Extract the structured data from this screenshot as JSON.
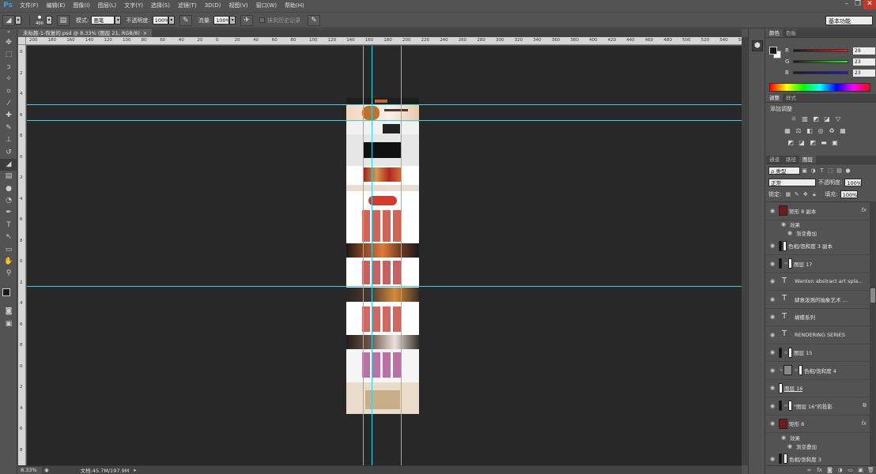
{
  "app": {
    "logo": "Ps"
  },
  "menu": [
    "文件(F)",
    "编辑(E)",
    "图像(I)",
    "图层(L)",
    "文字(Y)",
    "选择(S)",
    "滤镜(T)",
    "3D(D)",
    "视图(V)",
    "窗口(W)",
    "帮助(H)"
  ],
  "options": {
    "brush_size": "400",
    "mode_label": "模式:",
    "mode_value": "画笔",
    "opacity_label": "不透明度:",
    "opacity_value": "100%",
    "flow_label": "流量:",
    "flow_value": "100%",
    "history_label": "抹到历史记录",
    "workspace": "基本功能"
  },
  "document": {
    "tab_title": "未标题-1-恢复的.psd @ 8.33% (图层 21, RGB/8)",
    "zoom": "8.33%",
    "doc_size": "文档:45.7M/197.9M"
  },
  "rulers": {
    "h_ticks": [
      "200",
      "180",
      "160",
      "140",
      "120",
      "100",
      "80",
      "60",
      "40",
      "20",
      "0",
      "20",
      "40",
      "60",
      "80",
      "100",
      "120",
      "140",
      "160",
      "180",
      "200",
      "220",
      "240",
      "260",
      "280",
      "300",
      "320",
      "340",
      "360",
      "380",
      "400",
      "420",
      "440",
      "460",
      "480",
      "500",
      "520",
      "540",
      "560"
    ],
    "v_ticks": [
      "0",
      "2",
      "4",
      "6",
      "8",
      "0",
      "2",
      "4",
      "6",
      "8",
      "0",
      "2",
      "4",
      "6",
      "8",
      "0",
      "2",
      "4",
      "6",
      "8"
    ]
  },
  "color_panel": {
    "tabs": [
      "颜色",
      "色板"
    ],
    "r_label": "R",
    "r_value": "29",
    "g_label": "G",
    "g_value": "23",
    "b_label": "B",
    "b_value": "23",
    "fg_color": "#1d1717"
  },
  "adjustments_panel": {
    "tabs": [
      "调整",
      "样式"
    ],
    "title": "添加调整"
  },
  "layers_panel": {
    "tabs": [
      "通道",
      "路径",
      "图层"
    ],
    "filter_label": "ρ 类型",
    "blend_mode": "正常",
    "opacity_label": "不透明度:",
    "opacity_value": "100%",
    "lock_label": "锁定:",
    "fill_label": "填充:",
    "fill_value": "100%",
    "layers": [
      {
        "name": "矩形 8 副本",
        "kind": "shape",
        "fx": "fx"
      },
      {
        "name": "效果",
        "kind": "sub"
      },
      {
        "name": "渐变叠加",
        "kind": "sub2"
      },
      {
        "name": "色相/饱和度 3 副本",
        "kind": "mask"
      },
      {
        "name": "图层 17",
        "kind": "mask"
      },
      {
        "name": "Wanton abstract art spla...",
        "kind": "type"
      },
      {
        "name": "肆意泼溅的抽象艺术 ...",
        "kind": "type"
      },
      {
        "name": "蝴蝶系列",
        "kind": "type"
      },
      {
        "name": "RENDERING SERIES",
        "kind": "type"
      },
      {
        "name": "图层 15",
        "kind": "mask"
      },
      {
        "name": "色相/饱和度 4",
        "kind": "mask"
      },
      {
        "name": "图层 16",
        "kind": "plain"
      },
      {
        "name": "\"图层 16\"的投影",
        "kind": "mask"
      },
      {
        "name": "矩形 8",
        "kind": "shape",
        "fx": "fx"
      },
      {
        "name": "效果",
        "kind": "sub"
      },
      {
        "name": "渐变叠加",
        "kind": "sub2"
      },
      {
        "name": "色相/饱和度 3",
        "kind": "mask"
      }
    ]
  }
}
